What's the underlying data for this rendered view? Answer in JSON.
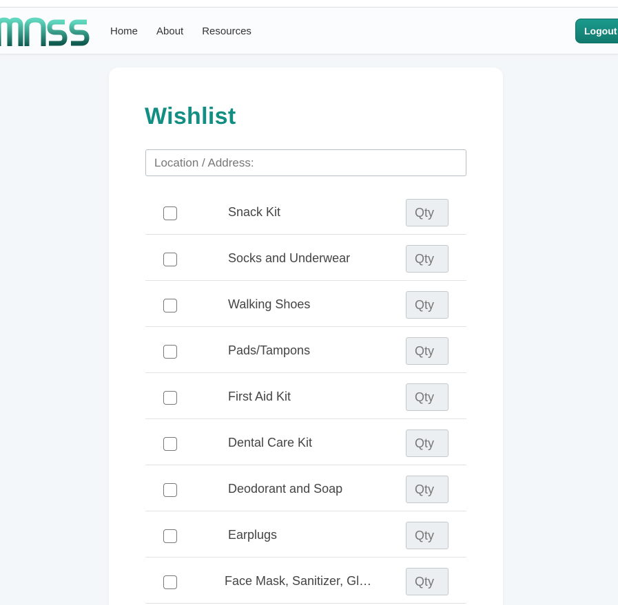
{
  "header": {
    "logo_text": "MASS",
    "nav": [
      "Home",
      "About",
      "Resources"
    ],
    "logout_label": "Logout",
    "brand_color": "#128f82"
  },
  "wishlist": {
    "title": "Wishlist",
    "location_placeholder": "Location / Address:",
    "qty_placeholder": "Qty",
    "items": [
      "Snack Kit",
      "Socks and Underwear",
      "Walking Shoes",
      "Pads/Tampons",
      "First Aid Kit",
      "Dental Care Kit",
      "Deodorant and Soap",
      "Earplugs",
      "Face Mask, Sanitizer, Gloves"
    ]
  }
}
